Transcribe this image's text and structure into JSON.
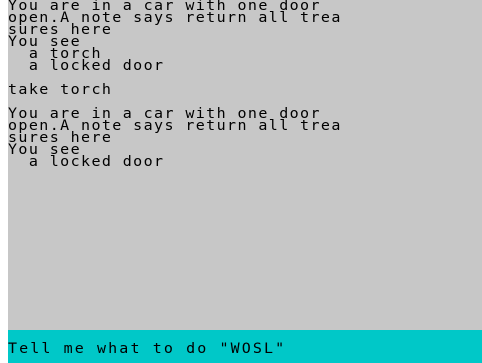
{
  "game": {
    "lines": [
      "You are in a car with one door",
      "open.A note says return all trea",
      "sures here",
      "You see",
      "  a torch",
      "  a locked door",
      "",
      "take torch",
      "",
      "You are in a car with one door",
      "open.A note says return all trea",
      "sures here",
      "You see",
      "  a locked door"
    ]
  },
  "status": {
    "prompt": "Tell me what to do \"WOSL\""
  },
  "colors": {
    "game_background": "#c7c7c7",
    "status_background": "#00c8c8",
    "text": "#000000"
  }
}
